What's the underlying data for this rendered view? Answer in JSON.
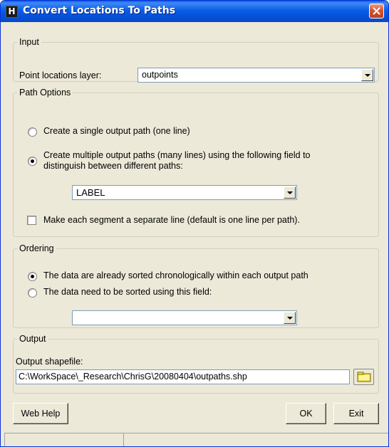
{
  "window": {
    "title": "Convert Locations To Paths",
    "icon_letter": "H"
  },
  "input": {
    "legend": "Input",
    "layer_label": "Point locations layer:",
    "layer_value": "outpoints"
  },
  "path_options": {
    "legend": "Path Options",
    "single_label": "Create a single output path (one line)",
    "multiple_label_line1": "Create multiple output paths (many lines) using the following field to",
    "multiple_label_line2": "distinguish between different paths:",
    "selected": "multiple",
    "field_value": "LABEL",
    "segment_label": "Make each segment a separate line (default is one line per path).",
    "segment_checked": false
  },
  "ordering": {
    "legend": "Ordering",
    "sorted_label": "The data are already sorted chronologically within each output path",
    "needsort_label": "The data need to be sorted using this field:",
    "selected": "sorted",
    "field_value": ""
  },
  "output": {
    "legend": "Output",
    "shapefile_label": "Output shapefile:",
    "shapefile_value": "C:\\WorkSpace\\_Research\\ChrisG\\20080404\\outpaths.shp"
  },
  "buttons": {
    "help": "Web Help",
    "ok": "OK",
    "exit": "Exit"
  }
}
